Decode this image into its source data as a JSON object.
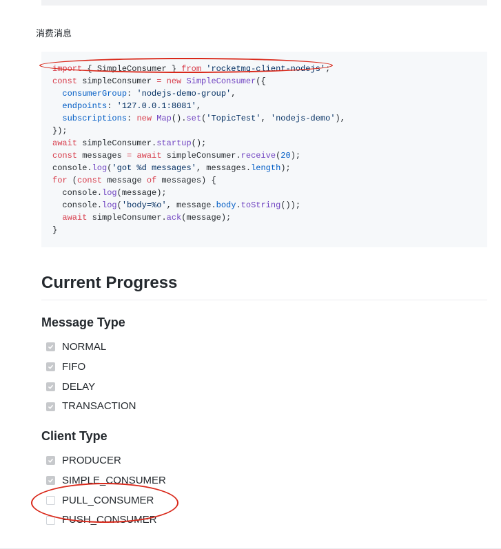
{
  "section_label": "消费消息",
  "code": {
    "l1": {
      "kw1": "import",
      "seg1": " { SimpleConsumer } ",
      "kw2": "from",
      "seg2": " ",
      "str1": "'rocketmq-client-nodejs'",
      "seg3": ";"
    },
    "l2": "",
    "l3": {
      "kw1": "const",
      "seg1": " simpleConsumer ",
      "op": "=",
      "seg2": " ",
      "kw2": "new",
      "seg3": " ",
      "cls": "SimpleConsumer",
      "seg4": "({"
    },
    "l4": {
      "ind": "  ",
      "prop": "consumerGroup",
      "seg1": ": ",
      "str": "'nodejs-demo-group'",
      "seg2": ","
    },
    "l5": {
      "ind": "  ",
      "prop": "endpoints",
      "seg1": ": ",
      "str": "'127.0.0.1:8081'",
      "seg2": ","
    },
    "l6": {
      "ind": "  ",
      "prop": "subscriptions",
      "seg1": ": ",
      "kw": "new",
      "seg2": " ",
      "cls": "Map",
      "seg3": "().",
      "fn": "set",
      "seg4": "(",
      "str1": "'TopicTest'",
      "seg5": ", ",
      "str2": "'nodejs-demo'",
      "seg6": "),"
    },
    "l7": "});",
    "l8": {
      "kw": "await",
      "seg1": " simpleConsumer.",
      "fn": "startup",
      "seg2": "();"
    },
    "l9": "",
    "l10": {
      "kw1": "const",
      "seg1": " messages ",
      "op": "=",
      "seg2": " ",
      "kw2": "await",
      "seg3": " simpleConsumer.",
      "fn": "receive",
      "seg4": "(",
      "num": "20",
      "seg5": ");"
    },
    "l11": {
      "seg1": "console.",
      "fn": "log",
      "seg2": "(",
      "str": "'got %d messages'",
      "seg3": ", messages.",
      "prop": "length",
      "seg4": ");"
    },
    "l12": {
      "kw1": "for",
      "seg1": " (",
      "kw2": "const",
      "seg2": " message ",
      "kw3": "of",
      "seg3": " messages) {"
    },
    "l13": {
      "ind": "  ",
      "seg1": "console.",
      "fn": "log",
      "seg2": "(message);"
    },
    "l14": {
      "ind": "  ",
      "seg1": "console.",
      "fn": "log",
      "seg2": "(",
      "str": "'body=%o'",
      "seg3": ", message.",
      "prop": "body",
      "seg4": ".",
      "fn2": "toString",
      "seg5": "());"
    },
    "l15": {
      "ind": "  ",
      "kw": "await",
      "seg1": " simpleConsumer.",
      "fn": "ack",
      "seg2": "(message);"
    },
    "l16": "}"
  },
  "heading": "Current Progress",
  "message_type": {
    "title": "Message Type",
    "items": [
      {
        "label": "NORMAL",
        "checked": true
      },
      {
        "label": "FIFO",
        "checked": true
      },
      {
        "label": "DELAY",
        "checked": true
      },
      {
        "label": "TRANSACTION",
        "checked": true
      }
    ]
  },
  "client_type": {
    "title": "Client Type",
    "items": [
      {
        "label": "PRODUCER",
        "checked": true
      },
      {
        "label": "SIMPLE_CONSUMER",
        "checked": true
      },
      {
        "label": "PULL_CONSUMER",
        "checked": false
      },
      {
        "label": "PUSH_CONSUMER",
        "checked": false
      }
    ]
  }
}
